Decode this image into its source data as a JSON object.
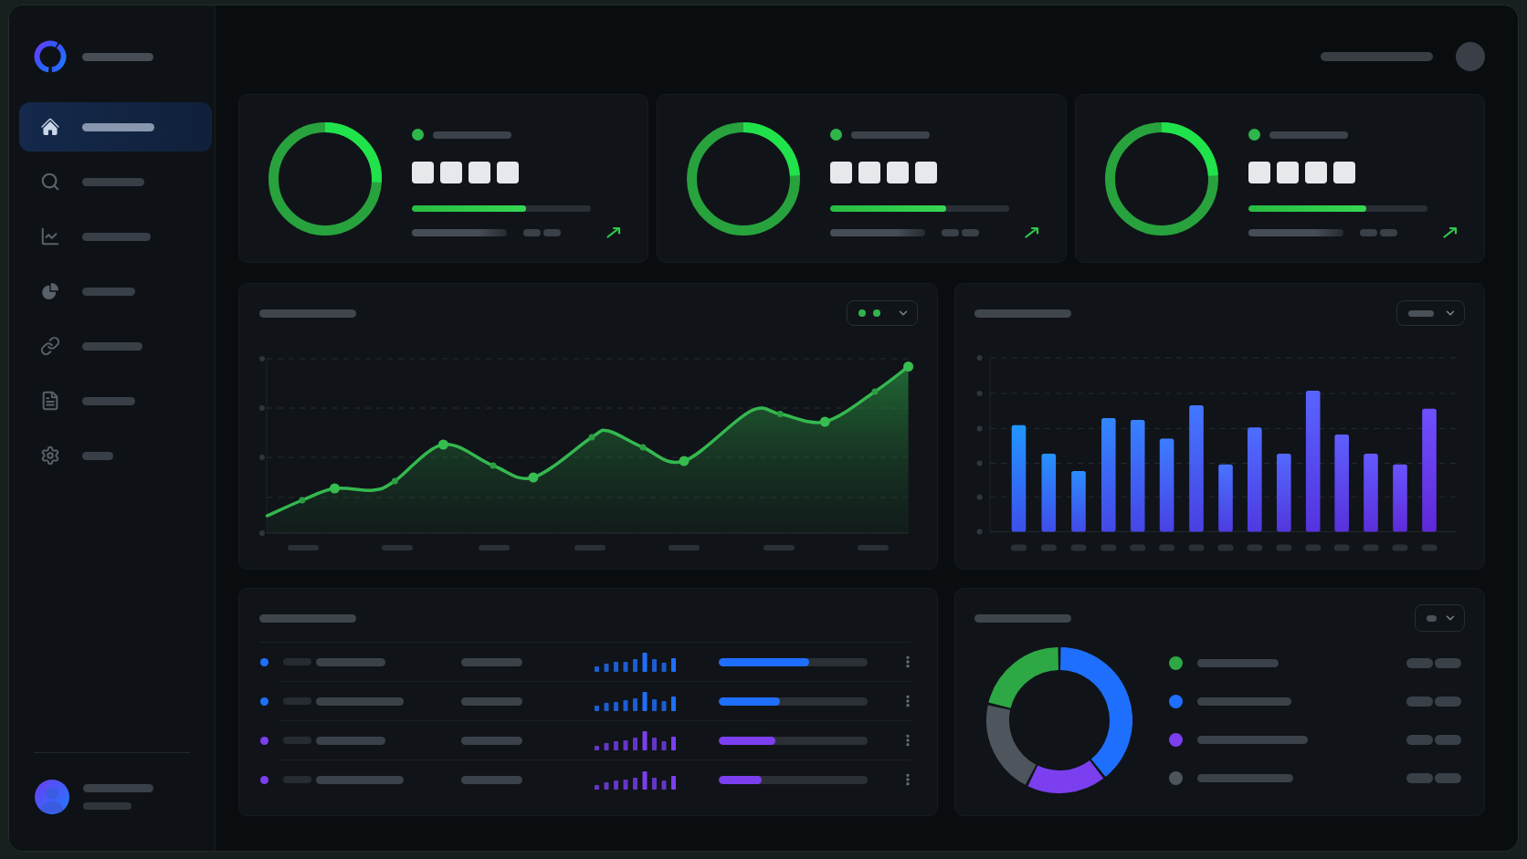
{
  "sidebar": {
    "nav_items": [
      {
        "kind": "home",
        "selected": true
      },
      {
        "kind": "search",
        "selected": false
      },
      {
        "kind": "line_chart",
        "selected": false
      },
      {
        "kind": "pie_chart",
        "selected": false
      },
      {
        "kind": "link",
        "selected": false
      },
      {
        "kind": "document",
        "selected": false
      },
      {
        "kind": "settings",
        "selected": false
      }
    ]
  },
  "kpi_cards": [
    {
      "ring": {
        "level": 0.26
      },
      "progress": {
        "level": 0.64
      }
    },
    {
      "ring": {
        "level": 0.24
      },
      "progress": {
        "level": 0.65
      }
    },
    {
      "ring": {
        "level": 0.24
      },
      "progress": {
        "level": 0.66
      }
    }
  ],
  "list_panel": {
    "rows": [
      {
        "color": "#1f6fff",
        "progress": {
          "level": 0.61
        }
      },
      {
        "color": "#1f6fff",
        "progress": {
          "level": 0.41
        }
      },
      {
        "color": "#7b3ff0",
        "progress": {
          "level": 0.38
        }
      },
      {
        "color": "#7b3ff0",
        "progress": {
          "level": 0.29
        }
      }
    ]
  },
  "breakdown_panel": {
    "legend": [
      {
        "color": "#2ea844"
      },
      {
        "color": "#1f6fff"
      },
      {
        "color": "#7b3ff0"
      },
      {
        "color": "#4f555d"
      }
    ]
  }
}
